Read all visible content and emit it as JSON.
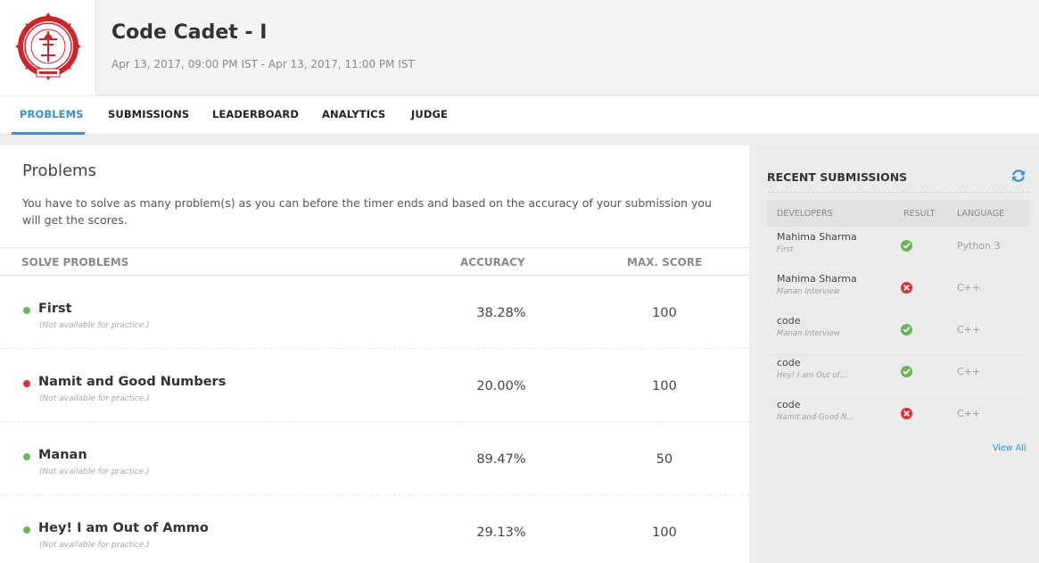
{
  "header": {
    "title": "Code Cadet - I",
    "dates": "Apr 13, 2017, 09:00 PM IST - Apr 13, 2017, 11:00 PM IST"
  },
  "tabs": [
    {
      "label": "PROBLEMS",
      "active": true
    },
    {
      "label": "SUBMISSIONS",
      "active": false
    },
    {
      "label": "LEADERBOARD",
      "active": false
    },
    {
      "label": "ANALYTICS",
      "active": false
    },
    {
      "label": "JUDGE",
      "active": false
    }
  ],
  "problems_section": {
    "title": "Problems",
    "description": "You have to solve as many problem(s) as you can before the timer ends and based on the accuracy of your submission you will get the scores.",
    "columns": {
      "name": "SOLVE PROBLEMS",
      "accuracy": "ACCURACY",
      "max_score": "MAX. SCORE"
    },
    "rows": [
      {
        "name": "First",
        "note": "(Not available for practice.)",
        "accuracy": "38.28%",
        "max_score": "100",
        "status_color": "#6cb35a"
      },
      {
        "name": "Namit and Good Numbers",
        "note": "(Not available for practice.)",
        "accuracy": "20.00%",
        "max_score": "100",
        "status_color": "#d9343c"
      },
      {
        "name": "Manan",
        "note": "(Not available for practice.)",
        "accuracy": "89.47%",
        "max_score": "50",
        "status_color": "#6cb35a"
      },
      {
        "name": "Hey! I am Out of Ammo",
        "note": "(Not available for practice.)",
        "accuracy": "29.13%",
        "max_score": "100",
        "status_color": "#6cb35a"
      }
    ]
  },
  "recent_submissions": {
    "title": "RECENT SUBMISSIONS",
    "refresh_icon": "refresh-icon",
    "columns": {
      "developers": "DEVELOPERS",
      "result": "RESULT",
      "language": "LANGUAGE"
    },
    "rows": [
      {
        "developer": "Mahima Sharma",
        "problem": "First",
        "result": "accepted",
        "language": "Python 3"
      },
      {
        "developer": "Mahima Sharma",
        "problem": "Manan Interview",
        "result": "wrong",
        "language": "C++"
      },
      {
        "developer": "code",
        "problem": "Manan Interview",
        "result": "accepted",
        "language": "C++"
      },
      {
        "developer": "code",
        "problem": "Hey! I am Out of...",
        "result": "accepted",
        "language": "C++"
      },
      {
        "developer": "code",
        "problem": "Namit and Good N...",
        "result": "wrong",
        "language": "C++"
      }
    ],
    "view_all": "View All"
  },
  "colors": {
    "accent": "#3d8fd1",
    "success": "#6cb35a",
    "error": "#d9343c"
  }
}
